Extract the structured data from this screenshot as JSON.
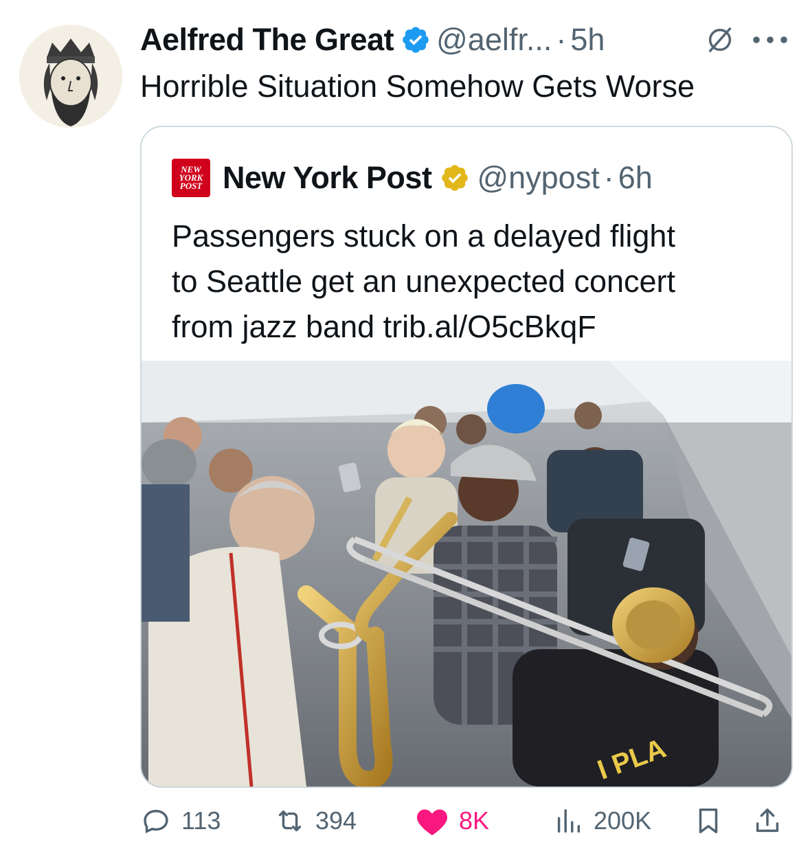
{
  "author": {
    "name": "Aelfred The Great",
    "handle": "@aelfr...",
    "separator": "·",
    "time": "5h"
  },
  "tweet": {
    "text": "Horrible Situation Somehow Gets Worse"
  },
  "quoted": {
    "logo_lines": [
      "NEW",
      "YORK",
      "POST"
    ],
    "name": "New York Post",
    "handle": "@nypost",
    "separator": "·",
    "time": "6h",
    "text_lines": [
      "Passengers stuck on a delayed flight",
      "to Seattle get an unexpected concert",
      "from jazz band trib.al/O5cBkqF"
    ],
    "media_shirt_text": "I PLA"
  },
  "actions": {
    "replies": "113",
    "reposts": "394",
    "likes": "8K",
    "views": "200K"
  },
  "colors": {
    "verified_blue": "#1d9bf0",
    "verified_gold": "#e2b719",
    "like_pink": "#f91880",
    "nyp_red": "#d0021b",
    "secondary_text": "#536471"
  },
  "icons": [
    "verified-badge-icon",
    "grok-icon",
    "more-icon",
    "gold-verified-badge-icon",
    "reply-icon",
    "repost-icon",
    "heart-icon",
    "views-icon",
    "bookmark-icon",
    "share-icon"
  ]
}
